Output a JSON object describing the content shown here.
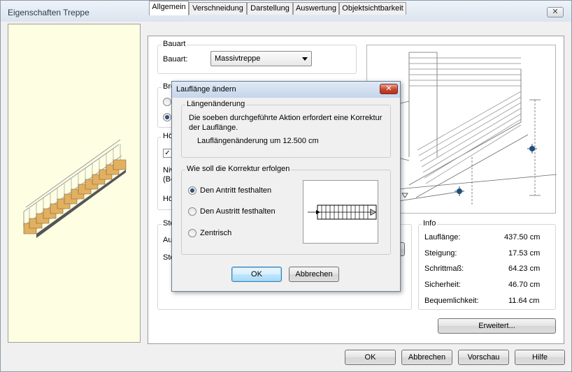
{
  "window": {
    "title": "Eigenschaften Treppe",
    "close_label": "✕"
  },
  "tabs": [
    {
      "label": "Allgemein"
    },
    {
      "label": "Verschneidung"
    },
    {
      "label": "Darstellung"
    },
    {
      "label": "Auswertung"
    },
    {
      "label": "Objektsichtbarkeit"
    }
  ],
  "bauart": {
    "group_label": "Bauart",
    "field_label": "Bauart:",
    "value": "Massivtreppe"
  },
  "partial_labels": {
    "breite_group": "Bre",
    "hoehe_group": "Hö",
    "niv_line1": "Niv",
    "niv_line2": "(Be",
    "hoe_label": "Hö",
    "steig_group": "Ste",
    "au_label": "Au",
    "ste_label": "Ste"
  },
  "info": {
    "group_label": "Info",
    "rows": [
      {
        "label": "Lauflänge:",
        "value": "437.50 cm"
      },
      {
        "label": "Steigung:",
        "value": "17.53 cm"
      },
      {
        "label": "Schrittmaß:",
        "value": "64.23 cm"
      },
      {
        "label": "Sicherheit:",
        "value": "46.70 cm"
      },
      {
        "label": "Bequemlichkeit:",
        "value": "11.64 cm"
      }
    ],
    "erweitert_label": "Erweitert..."
  },
  "footer": {
    "ok": "OK",
    "abbrechen": "Abbrechen",
    "vorschau": "Vorschau",
    "hilfe": "Hilfe"
  },
  "dialog": {
    "title": "Lauflänge ändern",
    "close_label": "✕",
    "group1_label": "Längenänderung",
    "message_line1": "Die soeben durchgeführte Aktion erfordert eine Korrektur",
    "message_line2": "der Lauflänge.",
    "change_text": "Lauflängenänderung um 12.500 cm",
    "group2_label": "Wie soll die Korrektur erfolgen",
    "options": [
      {
        "label": "Den Antritt festhalten",
        "selected": true
      },
      {
        "label": "Den Austritt festhalten",
        "selected": false
      },
      {
        "label": "Zentrisch",
        "selected": false
      }
    ],
    "ok": "OK",
    "abbrechen": "Abbrechen"
  }
}
